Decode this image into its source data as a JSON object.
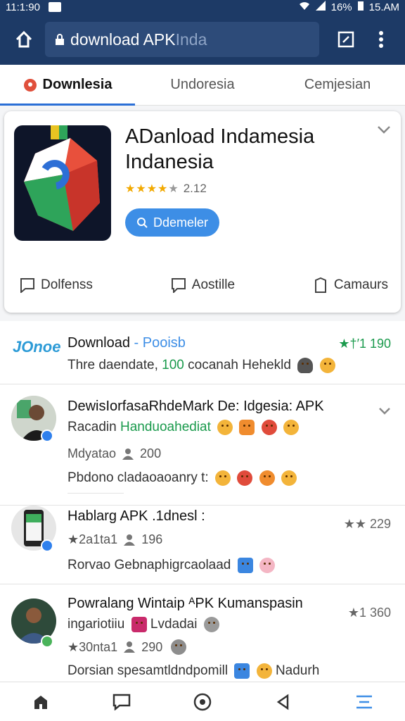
{
  "status": {
    "time": "11:1:90",
    "battery": "16%",
    "clock": "15.AM"
  },
  "browser": {
    "url_main": "ownload APK ",
    "url_dim": "Inda",
    "url_prefix": "d"
  },
  "tabs": [
    {
      "label": "Downlesia",
      "active": true
    },
    {
      "label": "Undoresia",
      "active": false
    },
    {
      "label": "Cemjesian",
      "active": false
    }
  ],
  "app": {
    "title": "ADanload Indamesia Indanesia",
    "rating": "2.12",
    "stars": 4,
    "button_label": "Ddemeler",
    "actions": [
      "Dolfenss",
      "Aostille",
      "Camaurs"
    ]
  },
  "feed": [
    {
      "brand": "JOnoe",
      "title": "Download",
      "title_suffix": "Pooisb",
      "sub_prefix": "Thre daendate,",
      "sub_highlight": "100",
      "sub_suffix": "cocanah Hehekld",
      "right": "★†′1 190"
    },
    {
      "title": "DewisIorfasaRhdeMark De: Idgesia: APK",
      "sub_prefix": "Racadin",
      "sub_green": "Handuoahediat",
      "meta_name": "Mdyatao",
      "meta_count": "200",
      "extra": "Pbdono cladaoaoanry t:"
    },
    {
      "title": "Hablarg APK .1dnesl :",
      "meta_left": "★2a1ta1",
      "meta_count": "196",
      "extra": "Rorvao Gebnaphigrcaolaad",
      "right": "★★ 229"
    },
    {
      "title": "Powralang Wintaip ᴬPK Kumanspasin",
      "sub_prefix": "ingariotiiu",
      "sub_suffix": "Lvdadai",
      "meta_left": "★30nta1",
      "meta_count": "290",
      "extra_prefix": "Dorsian spesamtldndpomill",
      "extra_suffix": "Nadurh",
      "right": "★1 360"
    }
  ],
  "colors": {
    "header": "#1d3a66",
    "accent": "#3d8ee6",
    "green": "#1a9a4c",
    "star": "#f2a900"
  }
}
